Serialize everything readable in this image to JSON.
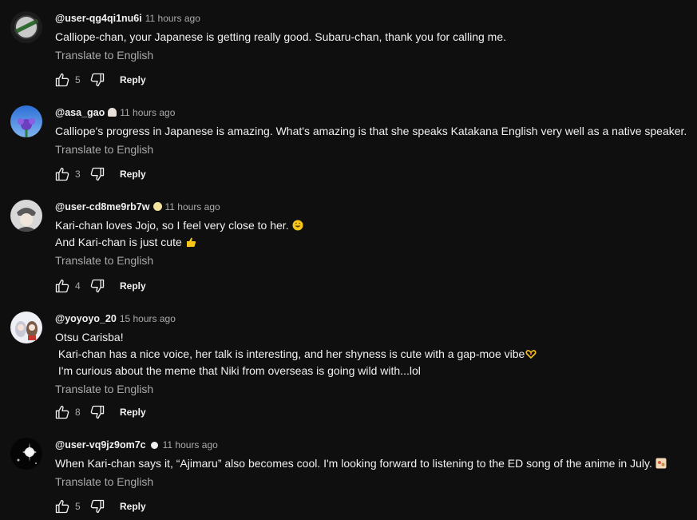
{
  "translate_label": "Translate to English",
  "reply_label": "Reply",
  "comments": [
    {
      "author": "@user-qg4qi1nu6i",
      "time": "11 hours ago",
      "lines": [
        "Calliope-chan, your Japanese is getting really good. Subaru-chan, thank you for calling me."
      ],
      "likes": "5"
    },
    {
      "author": "@asa_gao",
      "time": "11 hours ago",
      "lines": [
        "Calliope's progress in Japanese is amazing. What's amazing is that she speaks Katakana English very well as a native speaker."
      ],
      "likes": "3"
    },
    {
      "author": "@user-cd8me9rb7w",
      "time": "11 hours ago",
      "lines": [
        "Kari-chan loves Jojo, so I feel very close to her.",
        "And Kari-chan is just cute"
      ],
      "likes": "4"
    },
    {
      "author": "@yoyoyo_20",
      "time": "15 hours ago",
      "lines": [
        "Otsu Carisba!",
        " Kari-chan has a nice voice, her talk is interesting, and her shyness is cute with a gap-moe vibe",
        " I'm curious about the meme that Niki from overseas is going wild with...lol"
      ],
      "likes": "8"
    },
    {
      "author": "@user-vq9jz9om7c",
      "time": "11 hours ago",
      "lines": [
        "When Kari-chan says it, “Ajimaru” also becomes cool. I'm looking forward to listening to the ED song of the anime in July."
      ],
      "likes": "5"
    }
  ]
}
